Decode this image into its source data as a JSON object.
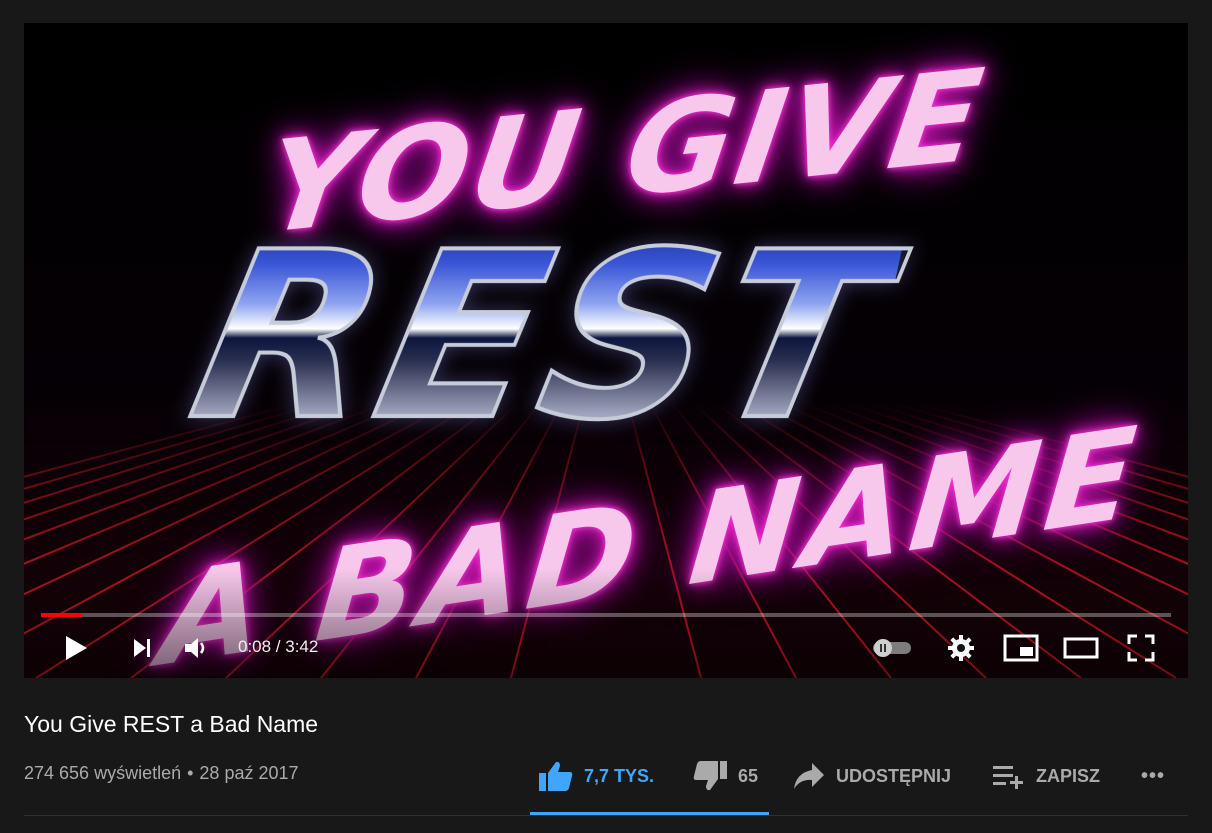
{
  "player": {
    "artwork": {
      "line1": "YOU GIVE",
      "line2": "REST",
      "line3": "A BAD NAME"
    },
    "time": "0:08 / 3:42",
    "progress_fraction": 0.036,
    "controls": {
      "play": "play-icon",
      "next": "next-icon",
      "volume": "volume-icon",
      "autoplay": "autoplay-toggle-icon",
      "settings": "gear-icon",
      "miniplayer": "miniplayer-icon",
      "theater": "theater-mode-icon",
      "fullscreen": "fullscreen-icon"
    }
  },
  "video": {
    "title": "You Give REST a Bad Name",
    "views": "274 656 wyświetleń",
    "separator": "•",
    "date": "28 paź 2017"
  },
  "actions": {
    "like_count": "7,7 TYS.",
    "dislike_count": "65",
    "share_label": "UDOSTĘPNIJ",
    "save_label": "ZAPISZ",
    "more_label": "•••"
  },
  "colors": {
    "accent_blue": "#3ea6ff",
    "progress_red": "#ff0000",
    "background": "#181818",
    "neon_pink": "#f8c8ec"
  }
}
